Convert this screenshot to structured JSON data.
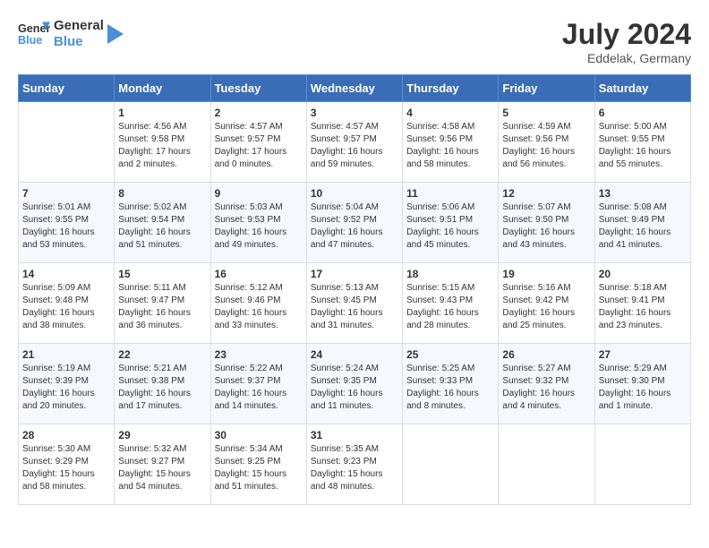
{
  "header": {
    "logo_line1": "General",
    "logo_line2": "Blue",
    "month_year": "July 2024",
    "location": "Eddelak, Germany"
  },
  "weekdays": [
    "Sunday",
    "Monday",
    "Tuesday",
    "Wednesday",
    "Thursday",
    "Friday",
    "Saturday"
  ],
  "weeks": [
    [
      {
        "day": "",
        "info": ""
      },
      {
        "day": "1",
        "info": "Sunrise: 4:56 AM\nSunset: 9:58 PM\nDaylight: 17 hours\nand 2 minutes."
      },
      {
        "day": "2",
        "info": "Sunrise: 4:57 AM\nSunset: 9:57 PM\nDaylight: 17 hours\nand 0 minutes."
      },
      {
        "day": "3",
        "info": "Sunrise: 4:57 AM\nSunset: 9:57 PM\nDaylight: 16 hours\nand 59 minutes."
      },
      {
        "day": "4",
        "info": "Sunrise: 4:58 AM\nSunset: 9:56 PM\nDaylight: 16 hours\nand 58 minutes."
      },
      {
        "day": "5",
        "info": "Sunrise: 4:59 AM\nSunset: 9:56 PM\nDaylight: 16 hours\nand 56 minutes."
      },
      {
        "day": "6",
        "info": "Sunrise: 5:00 AM\nSunset: 9:55 PM\nDaylight: 16 hours\nand 55 minutes."
      }
    ],
    [
      {
        "day": "7",
        "info": "Sunrise: 5:01 AM\nSunset: 9:55 PM\nDaylight: 16 hours\nand 53 minutes."
      },
      {
        "day": "8",
        "info": "Sunrise: 5:02 AM\nSunset: 9:54 PM\nDaylight: 16 hours\nand 51 minutes."
      },
      {
        "day": "9",
        "info": "Sunrise: 5:03 AM\nSunset: 9:53 PM\nDaylight: 16 hours\nand 49 minutes."
      },
      {
        "day": "10",
        "info": "Sunrise: 5:04 AM\nSunset: 9:52 PM\nDaylight: 16 hours\nand 47 minutes."
      },
      {
        "day": "11",
        "info": "Sunrise: 5:06 AM\nSunset: 9:51 PM\nDaylight: 16 hours\nand 45 minutes."
      },
      {
        "day": "12",
        "info": "Sunrise: 5:07 AM\nSunset: 9:50 PM\nDaylight: 16 hours\nand 43 minutes."
      },
      {
        "day": "13",
        "info": "Sunrise: 5:08 AM\nSunset: 9:49 PM\nDaylight: 16 hours\nand 41 minutes."
      }
    ],
    [
      {
        "day": "14",
        "info": "Sunrise: 5:09 AM\nSunset: 9:48 PM\nDaylight: 16 hours\nand 38 minutes."
      },
      {
        "day": "15",
        "info": "Sunrise: 5:11 AM\nSunset: 9:47 PM\nDaylight: 16 hours\nand 36 minutes."
      },
      {
        "day": "16",
        "info": "Sunrise: 5:12 AM\nSunset: 9:46 PM\nDaylight: 16 hours\nand 33 minutes."
      },
      {
        "day": "17",
        "info": "Sunrise: 5:13 AM\nSunset: 9:45 PM\nDaylight: 16 hours\nand 31 minutes."
      },
      {
        "day": "18",
        "info": "Sunrise: 5:15 AM\nSunset: 9:43 PM\nDaylight: 16 hours\nand 28 minutes."
      },
      {
        "day": "19",
        "info": "Sunrise: 5:16 AM\nSunset: 9:42 PM\nDaylight: 16 hours\nand 25 minutes."
      },
      {
        "day": "20",
        "info": "Sunrise: 5:18 AM\nSunset: 9:41 PM\nDaylight: 16 hours\nand 23 minutes."
      }
    ],
    [
      {
        "day": "21",
        "info": "Sunrise: 5:19 AM\nSunset: 9:39 PM\nDaylight: 16 hours\nand 20 minutes."
      },
      {
        "day": "22",
        "info": "Sunrise: 5:21 AM\nSunset: 9:38 PM\nDaylight: 16 hours\nand 17 minutes."
      },
      {
        "day": "23",
        "info": "Sunrise: 5:22 AM\nSunset: 9:37 PM\nDaylight: 16 hours\nand 14 minutes."
      },
      {
        "day": "24",
        "info": "Sunrise: 5:24 AM\nSunset: 9:35 PM\nDaylight: 16 hours\nand 11 minutes."
      },
      {
        "day": "25",
        "info": "Sunrise: 5:25 AM\nSunset: 9:33 PM\nDaylight: 16 hours\nand 8 minutes."
      },
      {
        "day": "26",
        "info": "Sunrise: 5:27 AM\nSunset: 9:32 PM\nDaylight: 16 hours\nand 4 minutes."
      },
      {
        "day": "27",
        "info": "Sunrise: 5:29 AM\nSunset: 9:30 PM\nDaylight: 16 hours\nand 1 minute."
      }
    ],
    [
      {
        "day": "28",
        "info": "Sunrise: 5:30 AM\nSunset: 9:29 PM\nDaylight: 15 hours\nand 58 minutes."
      },
      {
        "day": "29",
        "info": "Sunrise: 5:32 AM\nSunset: 9:27 PM\nDaylight: 15 hours\nand 54 minutes."
      },
      {
        "day": "30",
        "info": "Sunrise: 5:34 AM\nSunset: 9:25 PM\nDaylight: 15 hours\nand 51 minutes."
      },
      {
        "day": "31",
        "info": "Sunrise: 5:35 AM\nSunset: 9:23 PM\nDaylight: 15 hours\nand 48 minutes."
      },
      {
        "day": "",
        "info": ""
      },
      {
        "day": "",
        "info": ""
      },
      {
        "day": "",
        "info": ""
      }
    ]
  ]
}
